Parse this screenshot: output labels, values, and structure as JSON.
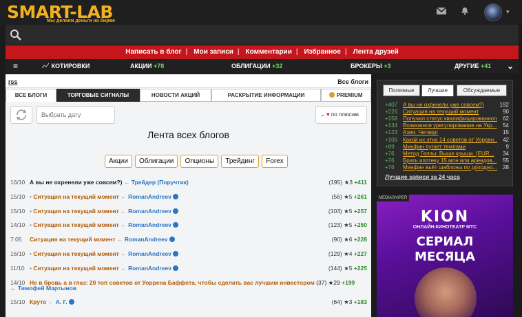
{
  "brand": {
    "logo": "SMART-LAB",
    "tagline": "Мы делаем деньги на бирже"
  },
  "header_icons": [
    "mail-icon",
    "bell-icon"
  ],
  "actions": [
    "Написать в блог",
    "Мои записи",
    "Комментарии",
    "Избранное",
    "Лента друзей"
  ],
  "nav": {
    "menu_icon": "menu-icon",
    "quotes": "КОТИРОВКИ",
    "stocks": "АКЦИИ",
    "stocks_chg": "+78",
    "bonds": "ОБЛИГАЦИИ",
    "bonds_chg": "+32",
    "brokers": "БРОКЕРЫ",
    "brokers_chg": "+3",
    "other": "ДРУГИЕ",
    "other_chg": "+41"
  },
  "main": {
    "rss": "rss",
    "all_blogs": "Все блоги",
    "tabs": [
      "ВСЕ БЛОГИ",
      "ТОРГОВЫЕ СИГНАЛЫ",
      "НОВОСТИ АКЦИЙ",
      "РАСКРЫТИЕ ИНФОРМАЦИИ",
      "PREMIUM"
    ],
    "date_placeholder": "Выбрать дату",
    "sort": "по плюсам",
    "title": "Лента всех блогов",
    "tags": [
      "Акции",
      "Облигации",
      "Опционы",
      "Трейдинг",
      "Forex"
    ]
  },
  "feed": [
    {
      "date": "16/10",
      "title": "А вы не охренели уже совсем?)",
      "author": "Трейдер (Поручтик)",
      "comments": "(195)",
      "stars": "★3",
      "score": "+411",
      "dot": false,
      "check": false
    },
    {
      "date": "15/10",
      "title": "Ситуация на текущий момент",
      "author": "RomanAndreev",
      "comments": "(56)",
      "stars": "★5",
      "score": "+261",
      "dot": true,
      "check": true
    },
    {
      "date": "15/10",
      "title": "Ситуация на текущий момент",
      "author": "RomanAndreev",
      "comments": "(103)",
      "stars": "★5",
      "score": "+257",
      "dot": true,
      "check": true
    },
    {
      "date": "14/10",
      "title": "Ситуация на текущий момент",
      "author": "RomanAndreev",
      "comments": "(123)",
      "stars": "★5",
      "score": "+250",
      "dot": true,
      "check": true
    },
    {
      "date": "7:05",
      "title": "Ситуация на текущий момент",
      "author": "RomanAndreev",
      "comments": "(90)",
      "stars": "★6",
      "score": "+228",
      "dot": false,
      "check": true
    },
    {
      "date": "16/10",
      "title": "Ситуация на текущий момент",
      "author": "RomanAndreev",
      "comments": "(129)",
      "stars": "★4",
      "score": "+227",
      "dot": true,
      "check": true
    },
    {
      "date": "11/10",
      "title": "Ситуация на текущий момент",
      "author": "RomanAndreev",
      "comments": "(144)",
      "stars": "★5",
      "score": "+225",
      "dot": true,
      "check": true
    }
  ],
  "feed_long": {
    "date": "14/10",
    "title": "Не в бровь а в глаз: 20 топ советов от Уоррена Баффета, чтобы сделать вас лучшим инвестором",
    "comments": "(37)",
    "stars": "★29",
    "score": "+199",
    "author": "Тимофей Мартынов"
  },
  "feed_last": {
    "date": "15/10",
    "title": "Круто",
    "author": "А. Г.",
    "comments": "(64)",
    "stars": "★3",
    "score": "+183"
  },
  "sidebar": {
    "tabs": [
      "Полезные",
      "Лучшие",
      "Обсуждаемые"
    ],
    "items": [
      {
        "s": "+407",
        "t": "А вы не охренели уже совсем?)",
        "n": "192"
      },
      {
        "s": "+226",
        "t": "Ситуация на текущий момент",
        "n": "90"
      },
      {
        "s": "+158",
        "t": "Получил статус квалифицированного",
        "n": "62"
      },
      {
        "s": "+134",
        "t": "Возможное урегулирование на Укр...",
        "n": "54"
      },
      {
        "s": "+123",
        "t": "Азия. Четверг",
        "n": "15"
      },
      {
        "s": "+106",
        "t": "Какой их этих 14 советов от Уоррен...",
        "n": "42"
      },
      {
        "s": "+89",
        "t": "Минфин пугает темпами",
        "n": "9"
      },
      {
        "s": "+76",
        "t": "Метод Гелпы: Выше крыши. (EUR...",
        "n": "34"
      },
      {
        "s": "+76",
        "t": "Брать ипотеку 15 млн или арендов...",
        "n": "55"
      },
      {
        "s": "+76",
        "t": "Минфин вьёт шаблоны по доходно...",
        "n": "28"
      }
    ],
    "best_link": "Лучшие записи за 24 часа"
  },
  "ad": {
    "label": "MEDIASNIPER",
    "brand": "KION",
    "sub": "ОНЛАЙН-КИНОТЕАТР МТС",
    "line1": "СЕРИАЛ",
    "line2": "МЕСЯЦА"
  }
}
